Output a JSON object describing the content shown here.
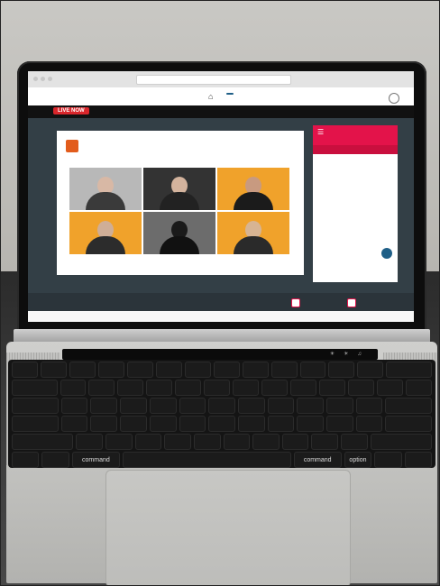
{
  "browser": {
    "url": ""
  },
  "site": {
    "nav_active": "",
    "nav_items": [],
    "nav_right": []
  },
  "live_badge": "LIVE NOW",
  "event_title": "",
  "slide": {
    "logo_text": ""
  },
  "participants": [
    {
      "bg": "#b8b8b8"
    },
    {
      "bg": "#333333"
    },
    {
      "bg": "#f0a22b"
    },
    {
      "bg": "#f0a22b"
    },
    {
      "bg": "#6c6c6c"
    },
    {
      "bg": "#f0a22b"
    }
  ],
  "chat": {
    "title": "",
    "tabs": [],
    "messages": []
  },
  "speaker": {
    "lines": []
  },
  "buttons": [],
  "bottom_tabs": [],
  "laptop": {
    "hinge_text": "",
    "touchbar_search": "",
    "keys": {
      "row0": [
        "",
        "",
        "",
        "",
        "",
        "",
        "",
        "",
        "",
        "",
        "",
        "",
        "",
        ""
      ],
      "row1": [
        "",
        "",
        "",
        "",
        "",
        "",
        "",
        "",
        "",
        "",
        "",
        "",
        "",
        ""
      ],
      "row2": [
        "",
        "",
        "",
        "",
        "",
        "",
        "",
        "",
        "",
        "",
        "",
        "",
        ""
      ],
      "row3": [
        "",
        "",
        "",
        "",
        "",
        "",
        "",
        "",
        "",
        "",
        "",
        "",
        ""
      ],
      "row4": [
        "",
        "",
        "",
        "",
        "",
        "",
        "",
        "",
        "",
        "",
        "",
        ""
      ],
      "row5": [
        "",
        "",
        "command",
        "",
        "",
        "",
        "command",
        "option",
        "",
        ""
      ]
    }
  }
}
